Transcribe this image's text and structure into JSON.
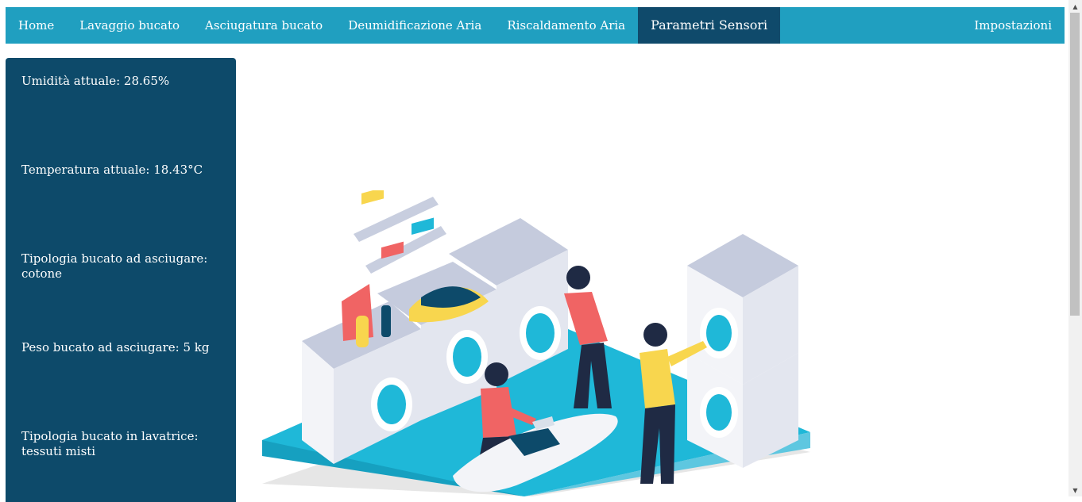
{
  "nav": {
    "items": [
      {
        "label": "Home"
      },
      {
        "label": "Lavaggio bucato"
      },
      {
        "label": "Asciugatura bucato"
      },
      {
        "label": "Deumidificazione Aria"
      },
      {
        "label": "Riscaldamento Aria"
      },
      {
        "label": "Parametri Sensori"
      }
    ],
    "settings": "Impostazioni",
    "active": "Parametri Sensori"
  },
  "sidebar": {
    "sensors": [
      {
        "label": "Umidità attuale:",
        "value": "28.65%"
      },
      {
        "label": "Temperatura attuale:",
        "value": "18.43°C"
      },
      {
        "label": "Tipologia bucato ad asciugare:",
        "value": "cotone"
      },
      {
        "label": "Peso bucato ad asciugare:",
        "value": "5 kg"
      },
      {
        "label": "Tipologia bucato in lavatrice:",
        "value": "tessuti misti"
      }
    ]
  },
  "colors": {
    "navbar": "#209fc0",
    "active_tab": "#0f4a6b",
    "sidebar": "#0d4a6a",
    "floor": "#1fb8d8"
  },
  "illustration": {
    "icon": "laundry-room-illustration"
  }
}
